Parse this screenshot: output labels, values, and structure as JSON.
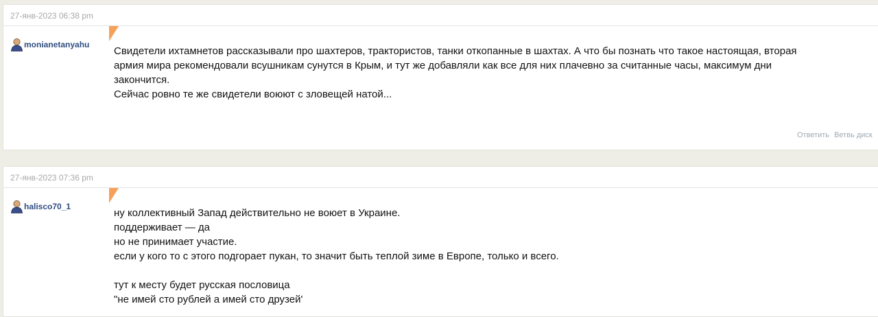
{
  "posts": [
    {
      "date": "27-янв-2023 06:38 pm",
      "author": "monianetanyahu",
      "lines": [
        "Свидетели ихтамнетов рассказывали про шахтеров, трактористов, танки откопанные в шахтах. А что бы познать что такое настоящая, вторая",
        "армия мира рекомендовали всушникам сунутся в Крым, и тут же добавляли как все для них плачевно за считанные часы, максимум дни",
        "закончится.",
        "Сейчас ровно те же свидетели воюют с зловещей натой..."
      ],
      "actions": {
        "reply": "Ответить",
        "thread": "Ветвь диск"
      }
    },
    {
      "date": "27-янв-2023 07:36 pm",
      "author": "halisco70_1",
      "lines": [
        "ну коллективный Запад действительно не воюет в Украине.",
        "поддерживает — да",
        "но не принимает участие.",
        "если у кого то с этого подгорает пукан, то значит быть теплой зиме в Европе, только и всего.",
        "",
        "тут к месту будет русская пословица",
        "\"не имей сто рублей а имей сто друзей'"
      ]
    }
  ],
  "colors": {
    "page_bg": "#eeeee6",
    "author_link": "#2f4d80",
    "corner_accent": "#f5a15a",
    "date_text": "#a8a8a8",
    "action_link": "#9fa9b3"
  },
  "icons": {
    "author": "user-avatar-icon",
    "corner": "orange-corner-flag-icon"
  }
}
